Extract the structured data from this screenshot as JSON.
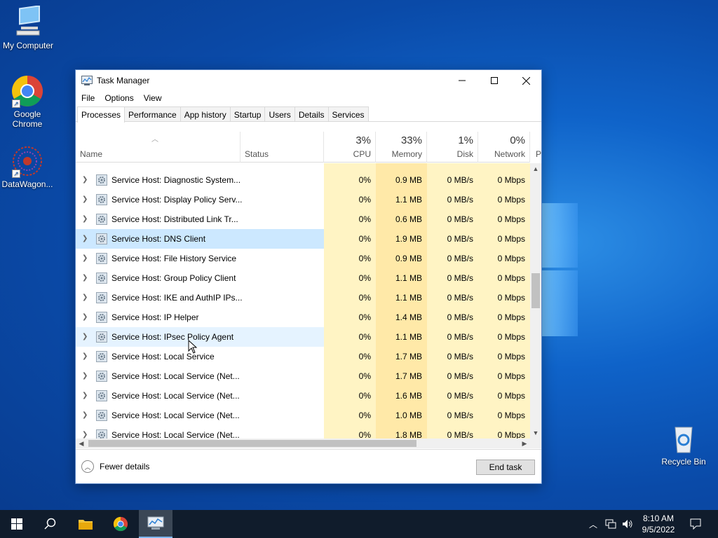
{
  "desktop": {
    "icons": [
      {
        "label": "My Computer"
      },
      {
        "label": "Google Chrome"
      },
      {
        "label": "DataWagon..."
      },
      {
        "label": "Recycle Bin"
      }
    ]
  },
  "window": {
    "title": "Task Manager",
    "menu": [
      "File",
      "Options",
      "View"
    ],
    "tabs": [
      "Processes",
      "Performance",
      "App history",
      "Startup",
      "Users",
      "Details",
      "Services"
    ],
    "active_tab": "Processes",
    "columns": {
      "name": "Name",
      "status": "Status",
      "cpu": {
        "label": "CPU",
        "pct": "3%"
      },
      "memory": {
        "label": "Memory",
        "pct": "33%"
      },
      "disk": {
        "label": "Disk",
        "pct": "1%"
      },
      "network": {
        "label": "Network",
        "pct": "0%"
      },
      "power_partial": "P"
    },
    "rows": [
      {
        "name": "Service Host: Diagnostic System...",
        "cpu": "0%",
        "mem": "0.9 MB",
        "disk": "0 MB/s",
        "net": "0 Mbps"
      },
      {
        "name": "Service Host: Display Policy Serv...",
        "cpu": "0%",
        "mem": "1.1 MB",
        "disk": "0 MB/s",
        "net": "0 Mbps"
      },
      {
        "name": "Service Host: Distributed Link Tr...",
        "cpu": "0%",
        "mem": "0.6 MB",
        "disk": "0 MB/s",
        "net": "0 Mbps"
      },
      {
        "name": "Service Host: DNS Client",
        "cpu": "0%",
        "mem": "1.9 MB",
        "disk": "0 MB/s",
        "net": "0 Mbps"
      },
      {
        "name": "Service Host: File History Service",
        "cpu": "0%",
        "mem": "0.9 MB",
        "disk": "0 MB/s",
        "net": "0 Mbps"
      },
      {
        "name": "Service Host: Group Policy Client",
        "cpu": "0%",
        "mem": "1.1 MB",
        "disk": "0 MB/s",
        "net": "0 Mbps"
      },
      {
        "name": "Service Host: IKE and AuthIP IPs...",
        "cpu": "0%",
        "mem": "1.1 MB",
        "disk": "0 MB/s",
        "net": "0 Mbps"
      },
      {
        "name": "Service Host: IP Helper",
        "cpu": "0%",
        "mem": "1.4 MB",
        "disk": "0 MB/s",
        "net": "0 Mbps"
      },
      {
        "name": "Service Host: IPsec Policy Agent",
        "cpu": "0%",
        "mem": "1.1 MB",
        "disk": "0 MB/s",
        "net": "0 Mbps"
      },
      {
        "name": "Service Host: Local Service",
        "cpu": "0%",
        "mem": "1.7 MB",
        "disk": "0 MB/s",
        "net": "0 Mbps"
      },
      {
        "name": "Service Host: Local Service (Net...",
        "cpu": "0%",
        "mem": "1.7 MB",
        "disk": "0 MB/s",
        "net": "0 Mbps"
      },
      {
        "name": "Service Host: Local Service (Net...",
        "cpu": "0%",
        "mem": "1.6 MB",
        "disk": "0 MB/s",
        "net": "0 Mbps"
      },
      {
        "name": "Service Host: Local Service (Net...",
        "cpu": "0%",
        "mem": "1.0 MB",
        "disk": "0 MB/s",
        "net": "0 Mbps"
      },
      {
        "name": "Service Host: Local Service (Net...",
        "cpu": "0%",
        "mem": "1.8 MB",
        "disk": "0 MB/s",
        "net": "0 Mbps"
      }
    ],
    "selected_row": "Service Host: DNS Client",
    "hover_row": "Service Host: IPsec Policy Agent",
    "footer": {
      "fewer_details": "Fewer details",
      "end_task": "End task"
    }
  },
  "taskbar": {
    "clock_time": "8:10 AM",
    "clock_date": "9/5/2022"
  },
  "colors": {
    "selection": "#cce8ff",
    "hover": "#e5f3ff",
    "heat_light": "#fff4c4",
    "heat_medium": "#ffe9a8",
    "taskbar": "#101c2c"
  }
}
